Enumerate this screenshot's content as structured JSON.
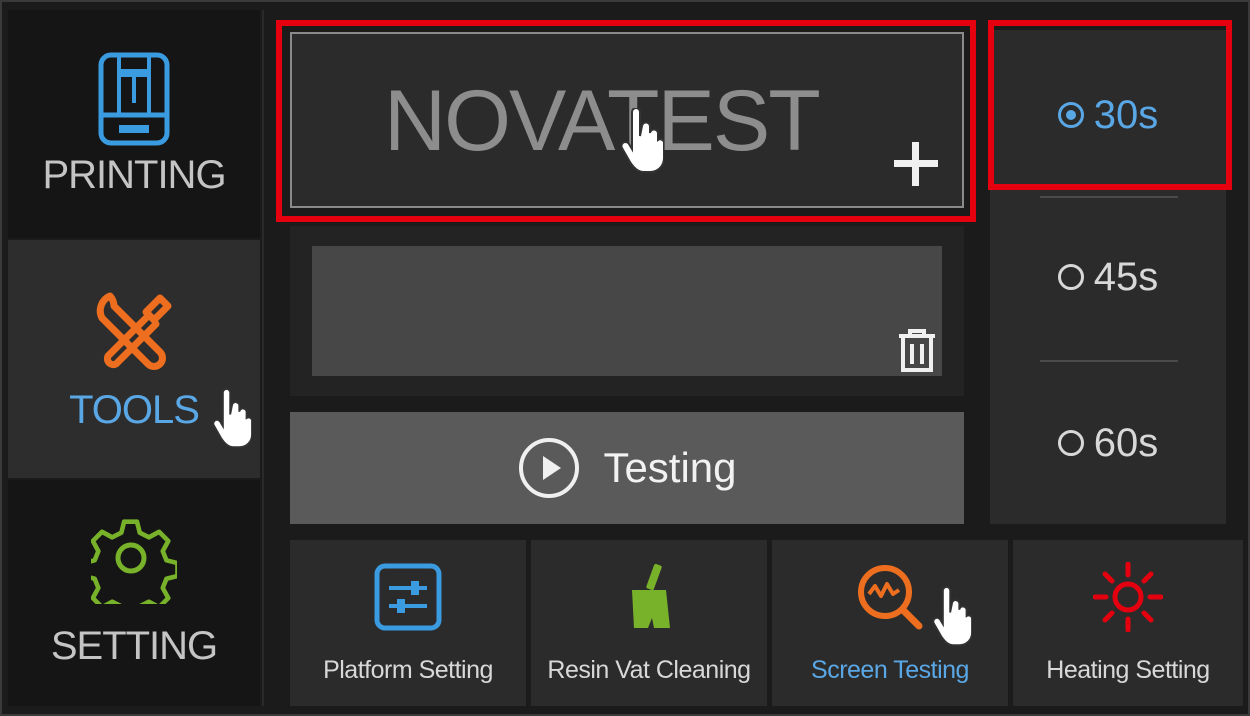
{
  "sidebar": {
    "items": [
      {
        "label": "PRINTING",
        "color": "#c4c4c4",
        "icon": "printer-icon"
      },
      {
        "label": "TOOLS",
        "color": "#5aa7e6",
        "icon": "tools-icon"
      },
      {
        "label": "SETTING",
        "color": "#c4c4c4",
        "icon": "gear-icon"
      }
    ]
  },
  "test_image": {
    "name": "NOVATEST",
    "add_icon": "plus-icon",
    "delete_icon": "trash-icon"
  },
  "testing": {
    "label": "Testing",
    "icon": "play-icon"
  },
  "durations": {
    "options": [
      "30s",
      "45s",
      "60s"
    ],
    "selected": "30s",
    "selected_color": "#5aa7e6"
  },
  "tabs": [
    {
      "label": "Platform Setting",
      "icon": "platform-sliders-icon"
    },
    {
      "label": "Resin Vat Cleaning",
      "icon": "broom-icon"
    },
    {
      "label": "Screen Testing",
      "icon": "screen-test-icon",
      "active": true
    },
    {
      "label": "Heating Setting",
      "icon": "heat-sun-icon"
    }
  ],
  "colors": {
    "highlight": "#e4000f",
    "accent_blue": "#5aa7e6",
    "orange": "#ee6e1f",
    "green": "#78b22a",
    "red": "#e4000f"
  }
}
